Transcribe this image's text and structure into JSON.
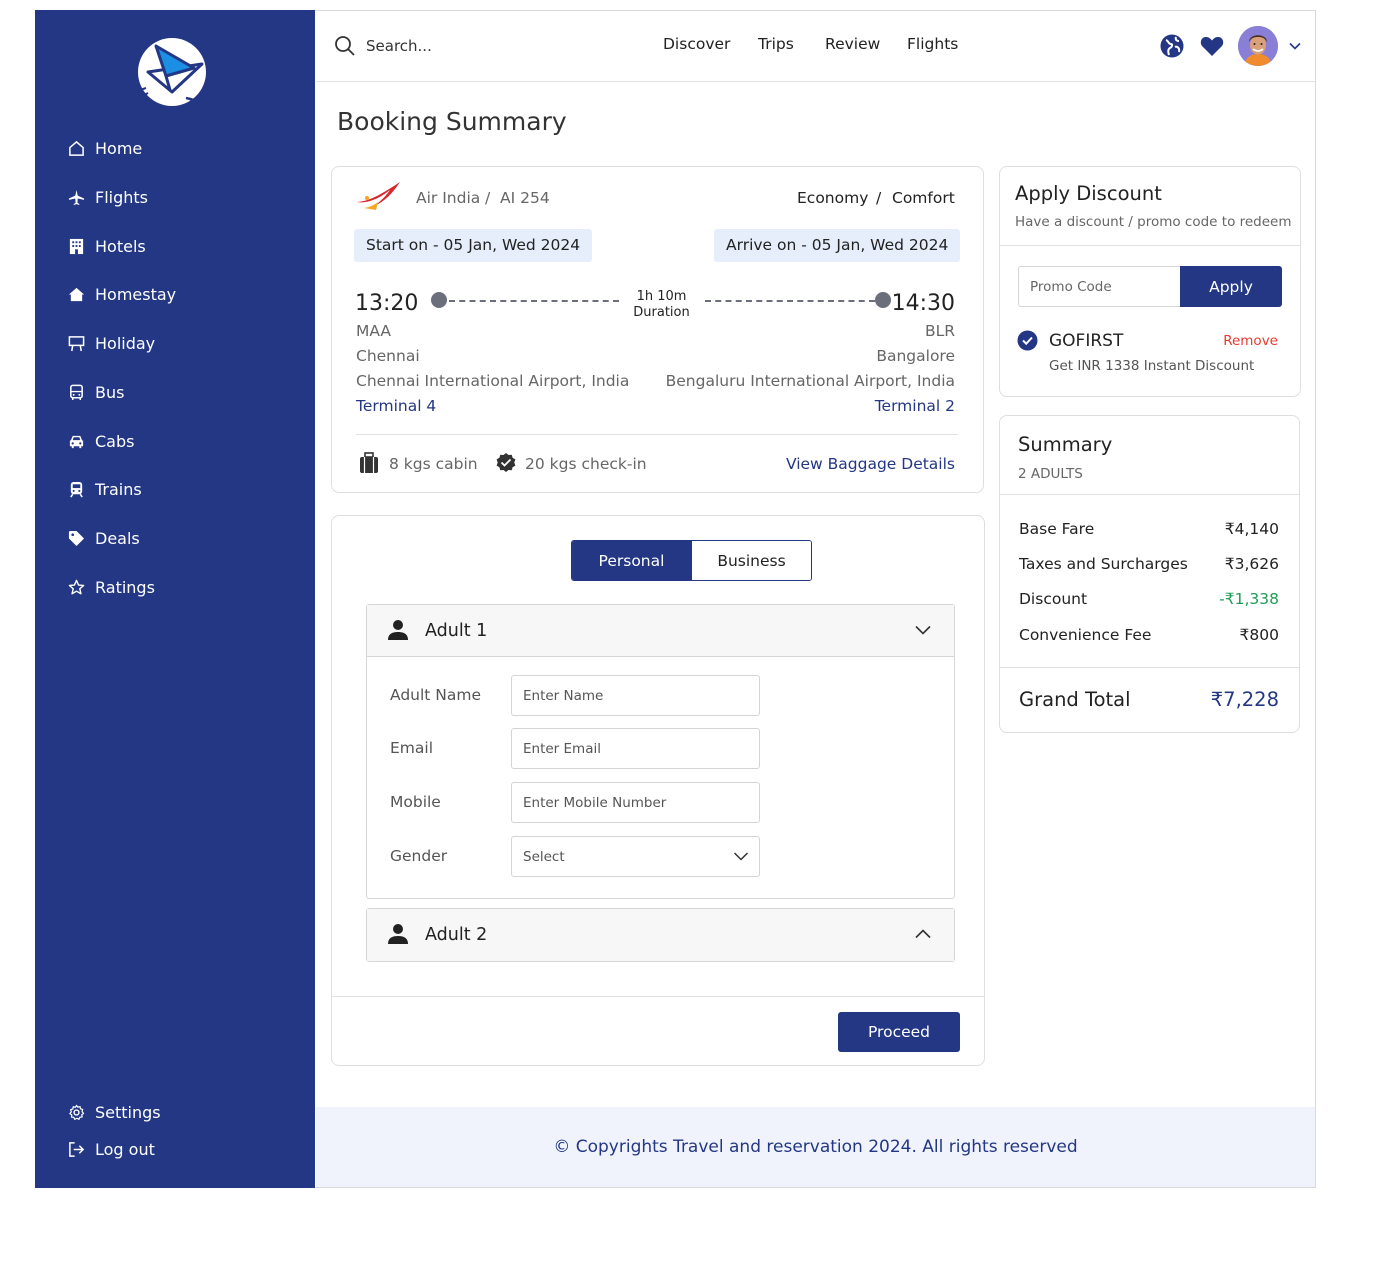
{
  "sidebar": {
    "items": [
      {
        "label": "Home",
        "icon": "home-icon"
      },
      {
        "label": "Flights",
        "icon": "plane-icon"
      },
      {
        "label": "Hotels",
        "icon": "building-icon"
      },
      {
        "label": "Homestay",
        "icon": "house-icon"
      },
      {
        "label": "Holiday",
        "icon": "easel-icon"
      },
      {
        "label": "Bus",
        "icon": "bus-icon"
      },
      {
        "label": "Cabs",
        "icon": "car-icon"
      },
      {
        "label": "Trains",
        "icon": "train-icon"
      },
      {
        "label": "Deals",
        "icon": "tag-icon"
      },
      {
        "label": "Ratings",
        "icon": "star-icon"
      }
    ],
    "bottom": [
      {
        "label": "Settings",
        "icon": "gear-icon"
      },
      {
        "label": "Log out",
        "icon": "logout-icon"
      }
    ]
  },
  "header": {
    "search_placeholder": "Search...",
    "nav": [
      "Discover",
      "Trips",
      "Review",
      "Flights"
    ]
  },
  "page_title": "Booking Summary",
  "flight": {
    "airline": "Air India",
    "separator": "/",
    "flight_no": "AI 254",
    "cabin": "Economy",
    "fare": "Comfort",
    "start": "Start on - 05 Jan, Wed 2024",
    "arrive": "Arrive on - 05 Jan, Wed 2024",
    "dep_time": "13:20",
    "arr_time": "14:30",
    "duration_value": "1h 10m",
    "duration_label": "Duration",
    "dep_code": "MAA",
    "arr_code": "BLR",
    "dep_city": "Chennai",
    "arr_city": "Bangalore",
    "dep_airport": "Chennai International Airport, India",
    "arr_airport": "Bengaluru International Airport, India",
    "dep_terminal": "Terminal 4",
    "arr_terminal": "Terminal 2",
    "cabin_baggage": "8 kgs cabin",
    "checkin_baggage": "20 kgs check-in",
    "baggage_link": "View Baggage Details"
  },
  "passengers": {
    "tabs": [
      "Personal",
      "Business"
    ],
    "adult1": {
      "title": "Adult 1",
      "fields": {
        "name_label": "Adult Name",
        "name_placeholder": "Enter Name",
        "email_label": "Email",
        "email_placeholder": "Enter Email",
        "mobile_label": "Mobile",
        "mobile_placeholder": "Enter Mobile Number",
        "gender_label": "Gender",
        "gender_value": "Select"
      }
    },
    "adult2": {
      "title": "Adult 2"
    },
    "proceed": "Proceed"
  },
  "discount": {
    "title": "Apply Discount",
    "subtitle": "Have a discount / promo code to redeem",
    "promo_placeholder": "Promo Code",
    "apply": "Apply",
    "applied_code": "GOFIRST",
    "remove": "Remove",
    "applied_desc": "Get INR 1338 Instant Discount"
  },
  "summary": {
    "title": "Summary",
    "subtitle": "2 ADULTS",
    "rows": [
      {
        "label": "Base Fare",
        "value": "₹4,140"
      },
      {
        "label": "Taxes and Surcharges",
        "value": "₹3,626"
      },
      {
        "label": "Discount",
        "value": "-₹1,338"
      },
      {
        "label": "Convenience Fee",
        "value": "₹800"
      }
    ],
    "total_label": "Grand Total",
    "total_value": "₹7,228"
  },
  "footer": "© Copyrights Travel and reservation 2024. All rights reserved",
  "colors": {
    "primary": "#233784",
    "remove": "#e53b2f",
    "discount": "#1f9d55",
    "pill": "#e6eefb"
  }
}
